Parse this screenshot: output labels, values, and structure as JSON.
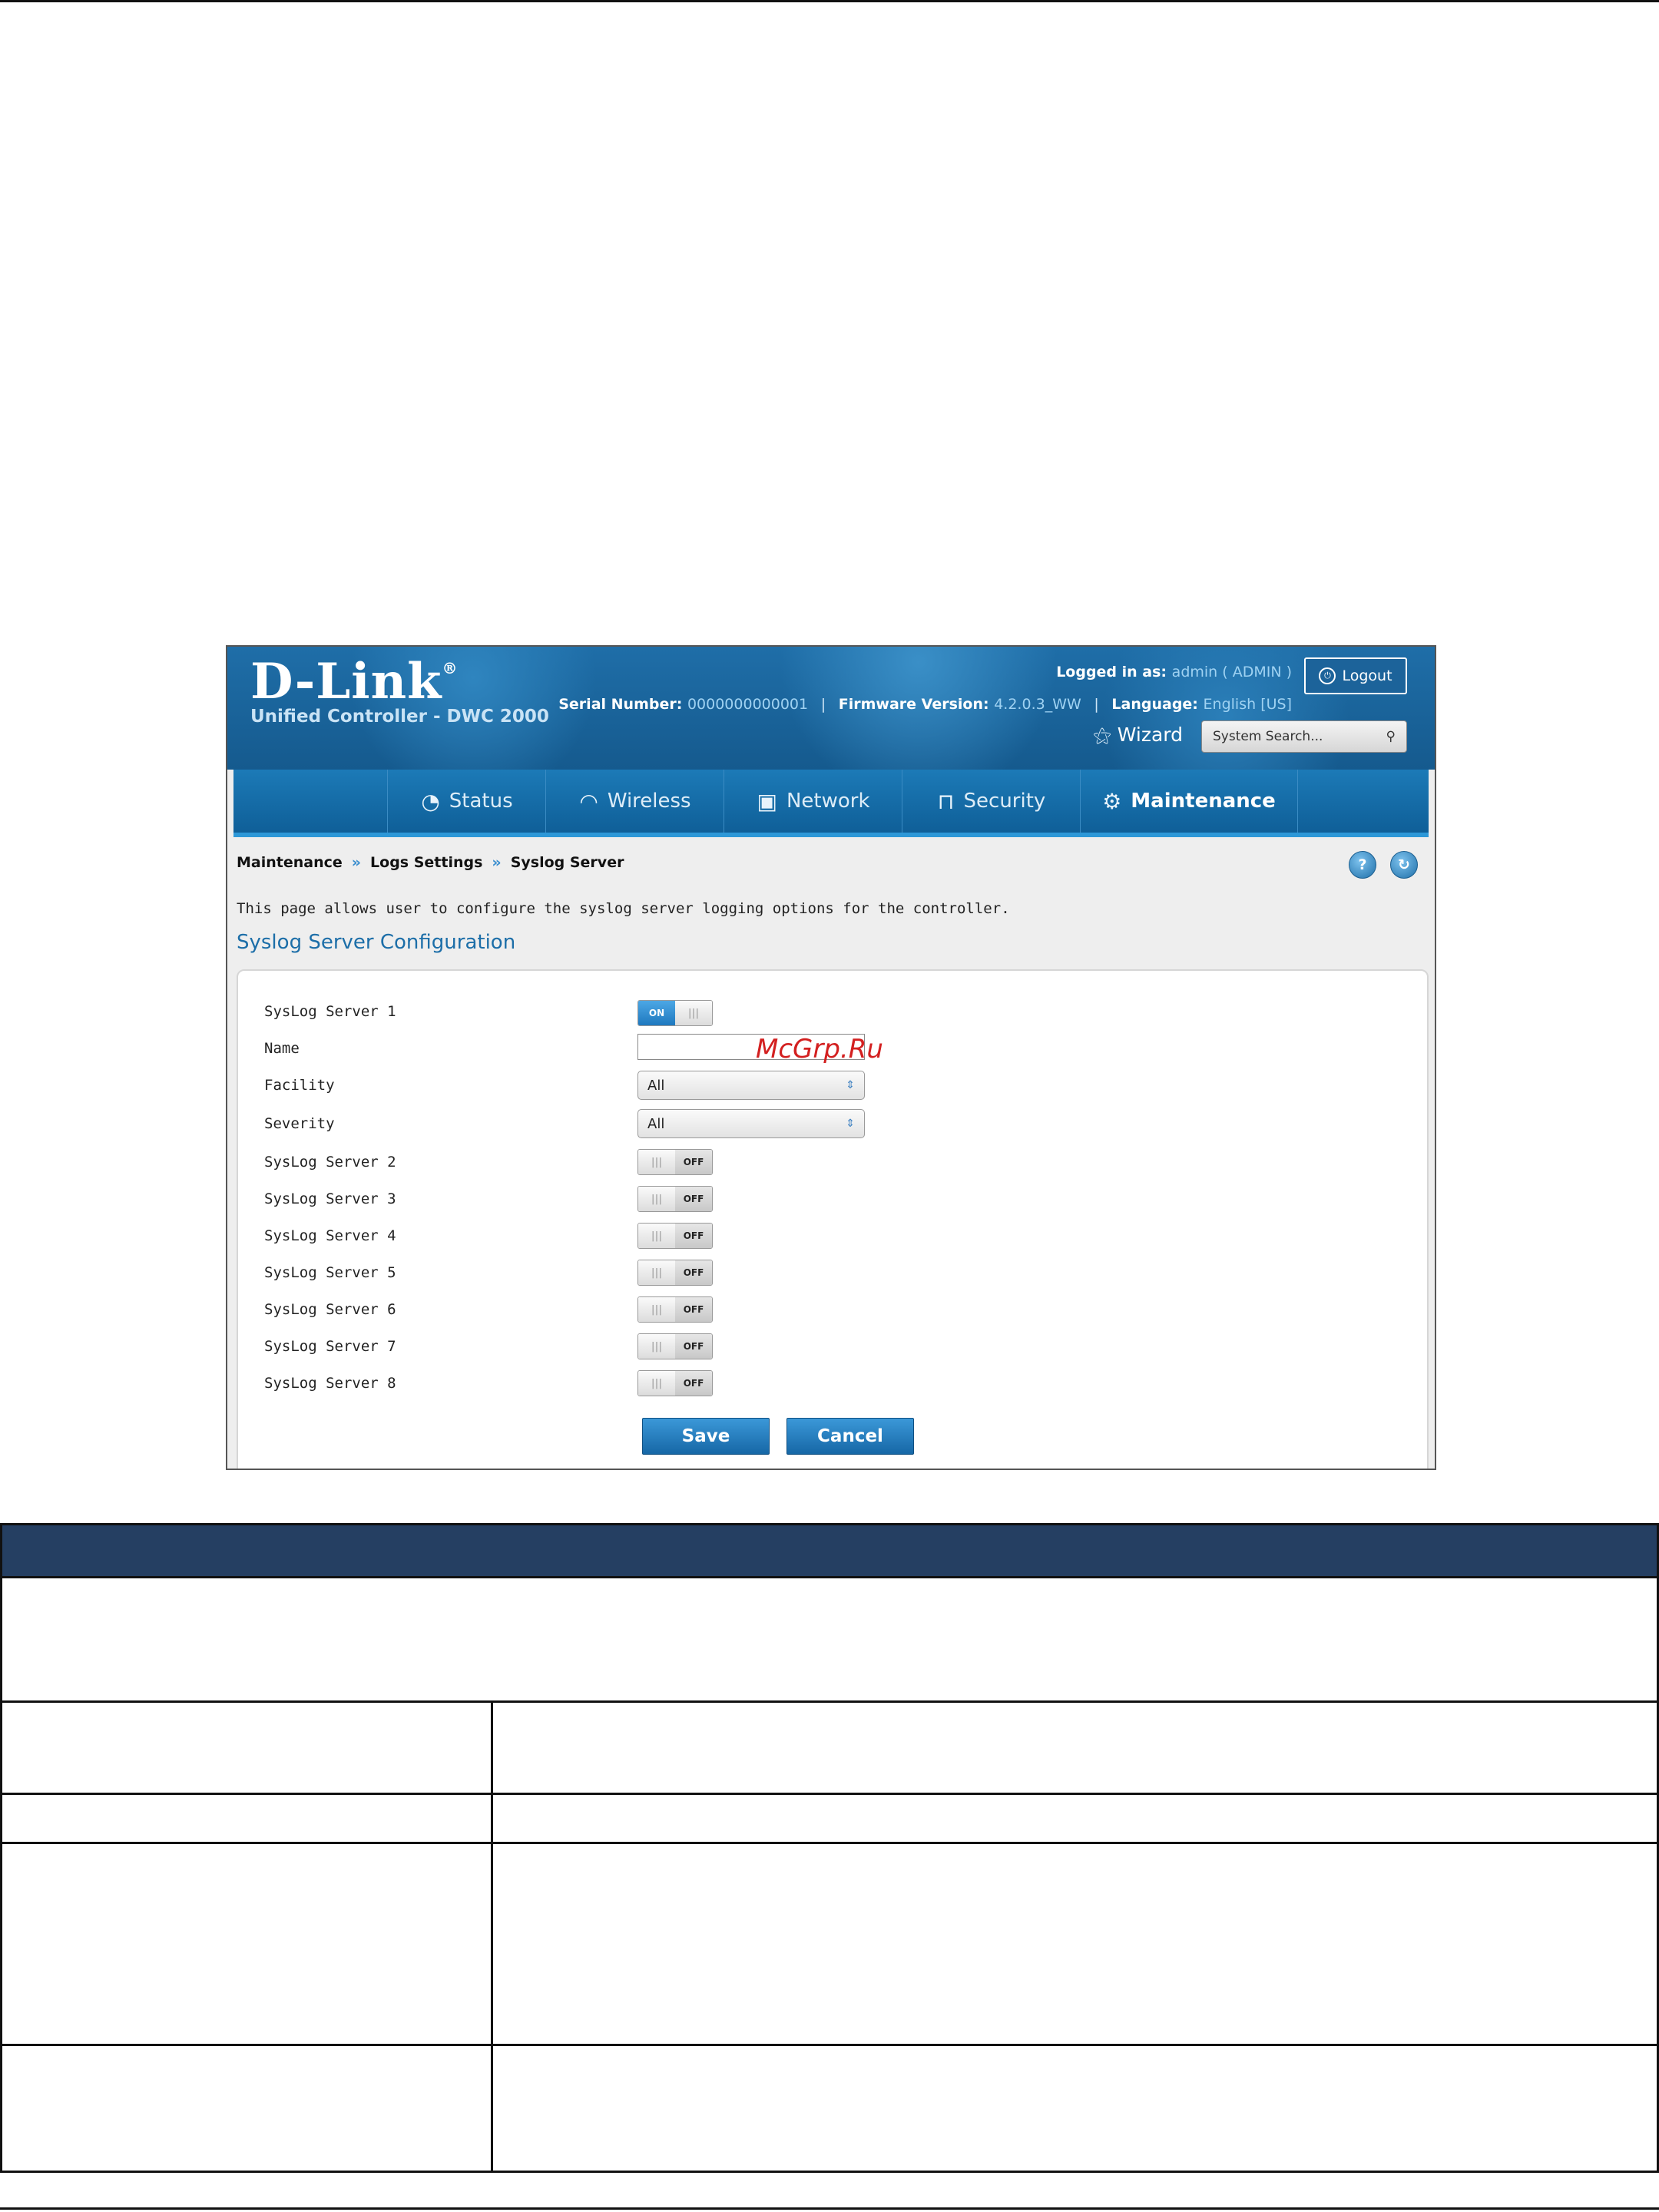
{
  "brand": {
    "logo": "D-Link",
    "registered": "®",
    "product": "Unified Controller - DWC 2000"
  },
  "header": {
    "logged_in_label": "Logged in as:",
    "logged_in_value": "admin ( ADMIN )",
    "logout": "Logout",
    "serial_label": "Serial Number:",
    "serial_value": "0000000000001",
    "firmware_label": "Firmware Version:",
    "firmware_value": "4.2.0.3_WW",
    "language_label": "Language:",
    "language_value": "English [US]",
    "wizard": "Wizard",
    "search_placeholder": "System Search..."
  },
  "nav": [
    {
      "label": "Status",
      "icon": "gauge-icon"
    },
    {
      "label": "Wireless",
      "icon": "wifi-icon"
    },
    {
      "label": "Network",
      "icon": "computer-icon"
    },
    {
      "label": "Security",
      "icon": "lock-icon"
    },
    {
      "label": "Maintenance",
      "icon": "gear-icon",
      "active": true
    }
  ],
  "breadcrumb": [
    "Maintenance",
    "Logs Settings",
    "Syslog Server"
  ],
  "breadcrumb_sep": "»",
  "description": "This page allows user to configure the syslog server logging options for the controller.",
  "section_title": "Syslog Server Configuration",
  "form": {
    "server1_label": "SysLog Server 1",
    "server1_state": "ON",
    "name_label": "Name",
    "name_value": "",
    "facility_label": "Facility",
    "facility_value": "All",
    "severity_label": "Severity",
    "severity_value": "All",
    "servers": [
      {
        "label": "SysLog Server 2",
        "state": "OFF"
      },
      {
        "label": "SysLog Server 3",
        "state": "OFF"
      },
      {
        "label": "SysLog Server 4",
        "state": "OFF"
      },
      {
        "label": "SysLog Server 5",
        "state": "OFF"
      },
      {
        "label": "SysLog Server 6",
        "state": "OFF"
      },
      {
        "label": "SysLog Server 7",
        "state": "OFF"
      },
      {
        "label": "SysLog Server 8",
        "state": "OFF"
      }
    ],
    "save": "Save",
    "cancel": "Cancel"
  },
  "watermark": "McGrp.Ru"
}
